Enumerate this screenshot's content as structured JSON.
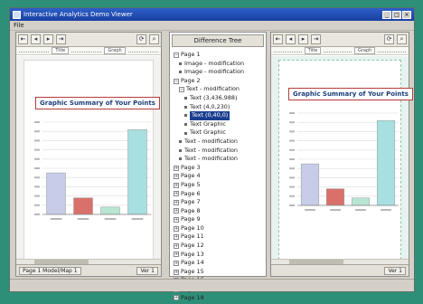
{
  "window": {
    "title": "Interactive Analytics Demo Viewer"
  },
  "menu": {
    "file": "File"
  },
  "left_pane": {
    "ruler_a": "Title",
    "ruler_b": "Graph",
    "chart_title": "Graphic Summary of Your Points",
    "status_left": "Page 1 Model/Map 1",
    "status_right": "Ver 1"
  },
  "right_pane": {
    "ruler_a": "Title",
    "ruler_b": "Graph",
    "chart_title": "Graphic Summary of Your Points",
    "status_right": "Ver 1"
  },
  "mid_pane": {
    "header": "Difference Tree",
    "tree": [
      {
        "label": "Page 1",
        "level": 0,
        "exp": "-"
      },
      {
        "label": "Image - modification",
        "level": 1,
        "exp": ""
      },
      {
        "label": "Image - modification",
        "level": 1,
        "exp": ""
      },
      {
        "label": "Page 2",
        "level": 0,
        "exp": "-"
      },
      {
        "label": "Text - modification",
        "level": 1,
        "exp": "-"
      },
      {
        "label": "Text (3,436,988)",
        "level": 2,
        "exp": ""
      },
      {
        "label": "Text (4,0,230)",
        "level": 2,
        "exp": ""
      },
      {
        "label": "Text (0,40,0)",
        "level": 2,
        "exp": "",
        "selected": true
      },
      {
        "label": "Text Graphic",
        "level": 2,
        "exp": ""
      },
      {
        "label": "Text Graphic",
        "level": 2,
        "exp": ""
      },
      {
        "label": "Text - modification",
        "level": 1,
        "exp": ""
      },
      {
        "label": "Text - modification",
        "level": 1,
        "exp": ""
      },
      {
        "label": "Text - modification",
        "level": 1,
        "exp": ""
      },
      {
        "label": "Page 3",
        "level": 0,
        "exp": "+"
      },
      {
        "label": "Page 4",
        "level": 0,
        "exp": "+"
      },
      {
        "label": "Page 5",
        "level": 0,
        "exp": "+"
      },
      {
        "label": "Page 6",
        "level": 0,
        "exp": "+"
      },
      {
        "label": "Page 7",
        "level": 0,
        "exp": "+"
      },
      {
        "label": "Page 8",
        "level": 0,
        "exp": "+"
      },
      {
        "label": "Page 9",
        "level": 0,
        "exp": "+"
      },
      {
        "label": "Page 10",
        "level": 0,
        "exp": "+"
      },
      {
        "label": "Page 11",
        "level": 0,
        "exp": "+"
      },
      {
        "label": "Page 12",
        "level": 0,
        "exp": "+"
      },
      {
        "label": "Page 13",
        "level": 0,
        "exp": "+"
      },
      {
        "label": "Page 14",
        "level": 0,
        "exp": "+"
      },
      {
        "label": "Page 15",
        "level": 0,
        "exp": "+"
      },
      {
        "label": "Page 16",
        "level": 0,
        "exp": "+"
      },
      {
        "label": "Page 17",
        "level": 0,
        "exp": "+"
      },
      {
        "label": "Page 18",
        "level": 0,
        "exp": "+"
      }
    ]
  },
  "chart_data": {
    "type": "bar",
    "categories": [
      "A",
      "B",
      "C",
      "D"
    ],
    "values": [
      45,
      18,
      8,
      92
    ],
    "colors": [
      "#c7cde9",
      "#d9716a",
      "#b8e6d3",
      "#a8dfe0"
    ],
    "ylim": [
      0,
      100
    ]
  }
}
